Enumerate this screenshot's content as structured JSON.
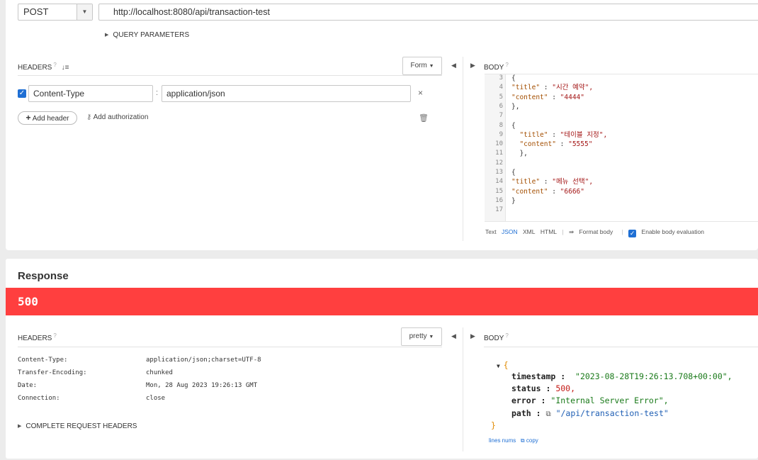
{
  "request": {
    "method": "POST",
    "url": "http://localhost:8080/api/transaction-test",
    "query_params_label": "QUERY PARAMETERS",
    "headers_label": "HEADERS",
    "headers_help": "?",
    "form_button": "Form",
    "header_rows": [
      {
        "enabled": true,
        "name": "Content-Type",
        "value": "application/json"
      }
    ],
    "add_header": "Add header",
    "add_authorization": "Add authorization",
    "body_label": "BODY",
    "body_help": "?",
    "body_lines": [
      {
        "n": "3",
        "text": "{"
      },
      {
        "n": "4",
        "key": "\"title\"",
        "val": "\"시간 예약\","
      },
      {
        "n": "5",
        "key": "\"content\"",
        "val": "\"4444\""
      },
      {
        "n": "6",
        "text": "},"
      },
      {
        "n": "7",
        "text": ""
      },
      {
        "n": "8",
        "text": "{"
      },
      {
        "n": "9",
        "key": "  \"title\"",
        "val": "\"테이블 지정\","
      },
      {
        "n": "10",
        "key": "  \"content\"",
        "val": "\"5555\""
      },
      {
        "n": "11",
        "text": "  },"
      },
      {
        "n": "12",
        "text": ""
      },
      {
        "n": "13",
        "text": "{"
      },
      {
        "n": "14",
        "key": "\"title\"",
        "val": "\"메뉴 선택\","
      },
      {
        "n": "15",
        "key": "\"content\"",
        "val": "\"6666\""
      },
      {
        "n": "16",
        "text": "}"
      },
      {
        "n": "17",
        "text": ""
      }
    ],
    "format_options": [
      "Text",
      "JSON",
      "XML",
      "HTML"
    ],
    "format_body": "Format body",
    "enable_body_evaluation": "Enable body evaluation"
  },
  "response": {
    "title": "Response",
    "status": "500",
    "headers_label": "HEADERS",
    "headers_help": "?",
    "pretty_button": "pretty",
    "headers": [
      {
        "name": "Content-Type:",
        "value": "application/json;charset=UTF-8"
      },
      {
        "name": "Transfer-Encoding:",
        "value": "chunked"
      },
      {
        "name": "Date:",
        "value": "Mon, 28 Aug 2023 19:26:13 GMT"
      },
      {
        "name": "Connection:",
        "value": "close"
      }
    ],
    "complete_request_headers": "COMPLETE REQUEST HEADERS",
    "body_label": "BODY",
    "body_help": "?",
    "body": {
      "open": "{",
      "close": "}",
      "timestamp_key": "timestamp :",
      "timestamp_val": "\"2023-08-28T19:26:13.708+00:00\",",
      "status_key": "status :",
      "status_val": "500,",
      "error_key": "error :",
      "error_val": "\"Internal Server Error\",",
      "path_key": "path :",
      "path_val": "\"/api/transaction-test\""
    },
    "lines_nums": "lines nums",
    "copy": "copy"
  },
  "colors": {
    "status_error": "#ff3f3f",
    "accent": "#1f6fd4"
  }
}
